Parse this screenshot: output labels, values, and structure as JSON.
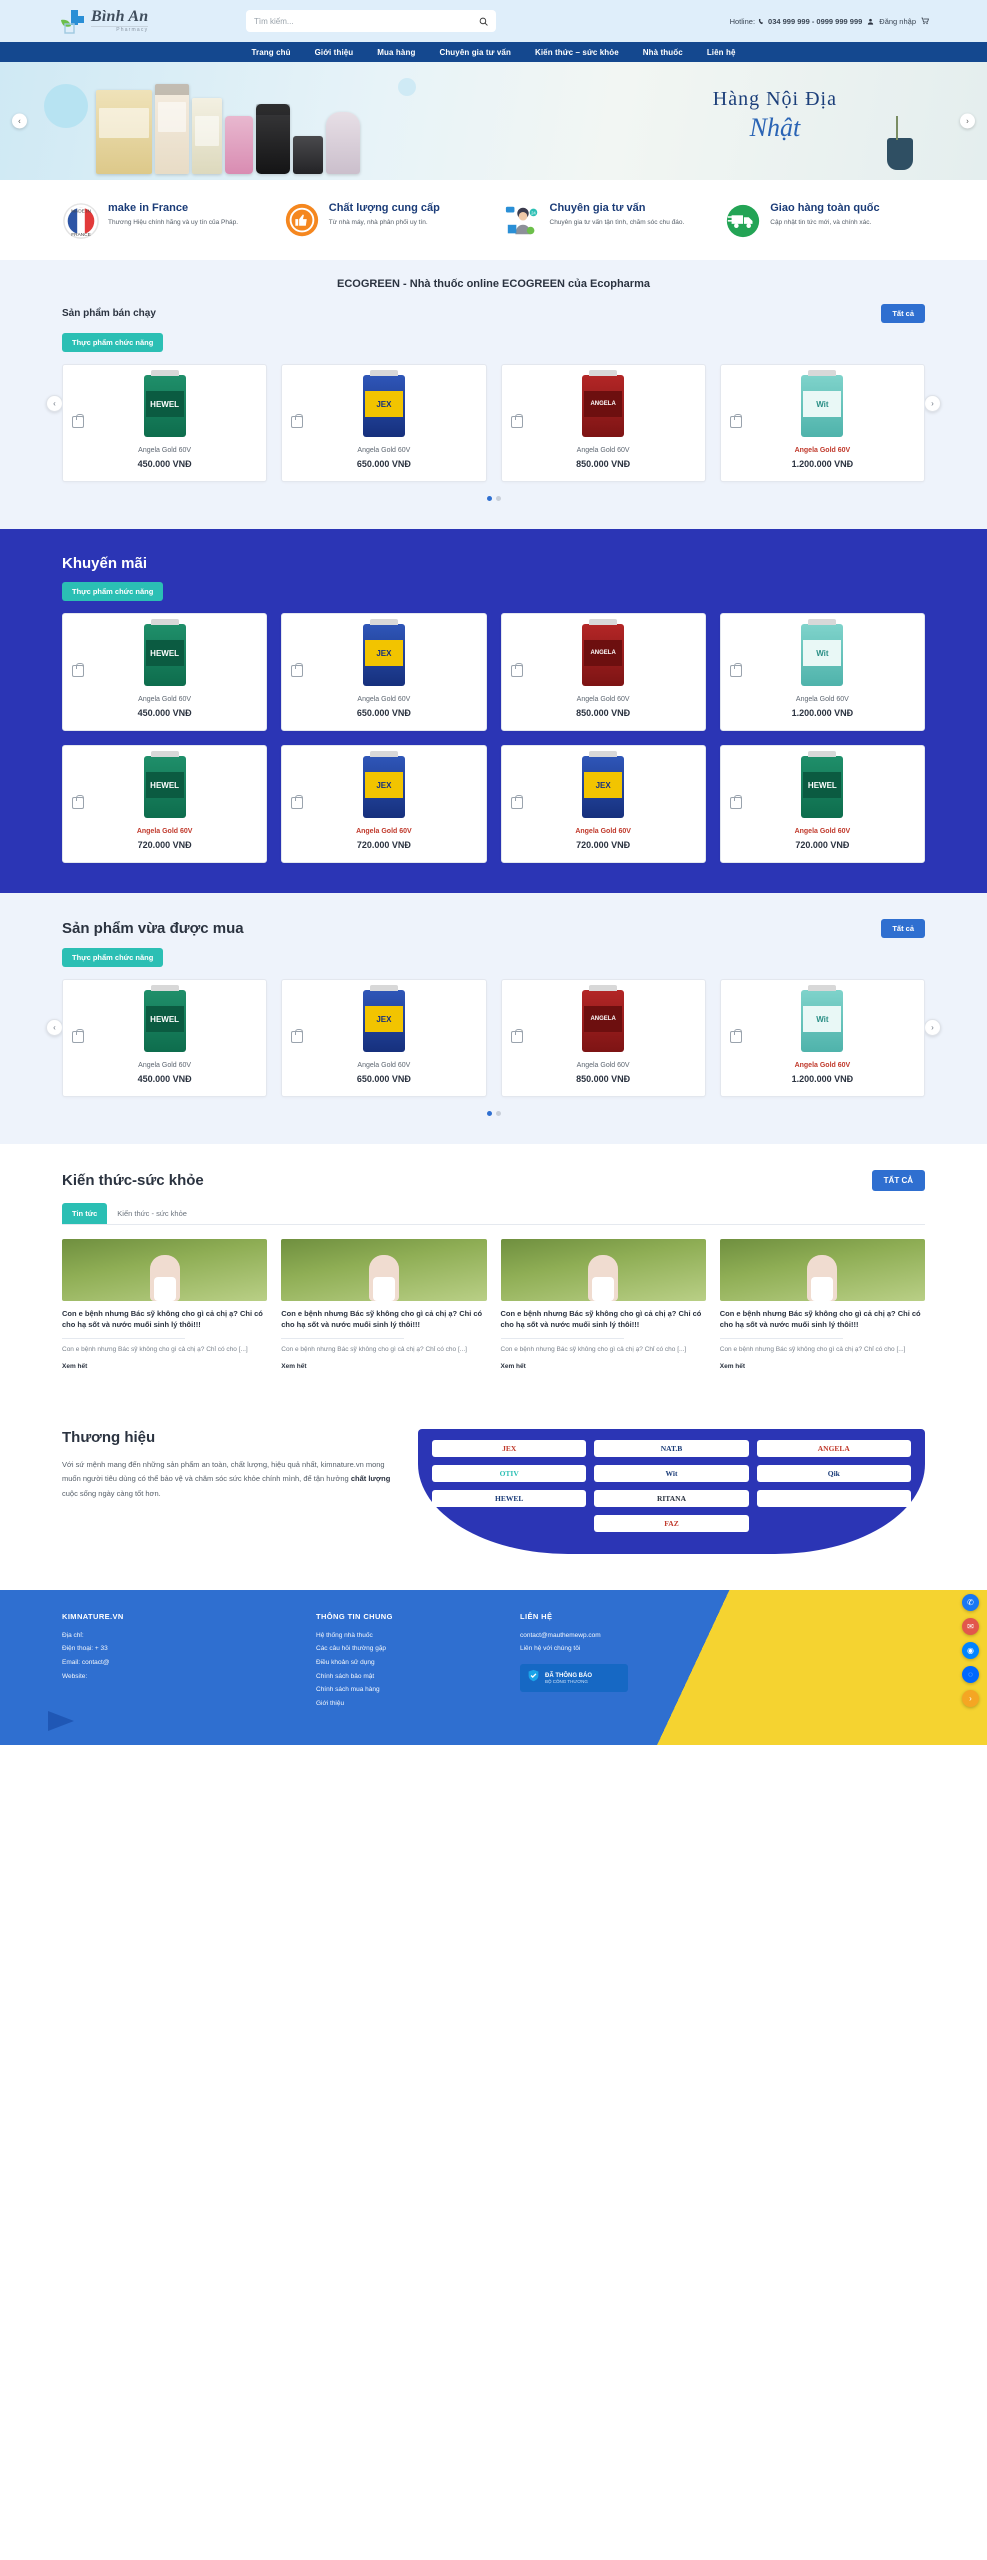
{
  "header": {
    "logo_name": "Bình An",
    "logo_sub": "Pharmacy",
    "logo_icon": "pharmacy-cross-leaf-icon",
    "search_placeholder": "Tìm kiếm...",
    "search_value": "",
    "search_icon": "search-icon",
    "hotline_label": "Hotline:",
    "phone_icon": "phone-icon",
    "hotline_numbers": "034 999 999 - 0999 999 999",
    "user_icon": "user-icon",
    "login_label": "Đăng nhập",
    "cart_icon": "cart-icon"
  },
  "nav": {
    "items": [
      {
        "label": "Trang chủ"
      },
      {
        "label": "Giới thiệu"
      },
      {
        "label": "Mua hàng"
      },
      {
        "label": "Chuyên gia tư vấn"
      },
      {
        "label": "Kiến thức – sức khỏe"
      },
      {
        "label": "Nhà thuốc"
      },
      {
        "label": "Liên hệ"
      }
    ]
  },
  "hero": {
    "title_line1": "Hàng Nội Địa",
    "title_line2": "Nhật",
    "prev_icon": "chevron-left-icon",
    "next_icon": "chevron-right-icon"
  },
  "features": [
    {
      "icon": "made-in-france-badge-icon",
      "title": "make in France",
      "desc": "Thương Hiệu chính hãng và uy tín của Pháp."
    },
    {
      "icon": "quality-thumbsup-badge-icon",
      "title": "Chất lượng cung cấp",
      "desc": "Từ nhà máy, nhà phân phối uy tín."
    },
    {
      "icon": "consultant-headset-icon",
      "title": "Chuyên gia tư vấn",
      "desc": "Chuyên gia tư vấn tận tình, chăm sóc chu đáo."
    },
    {
      "icon": "delivery-truck-icon",
      "title": "Giao hàng toàn quốc",
      "desc": "Cập nhật tin tức mới, và chính xác."
    }
  ],
  "best": {
    "banner_title": "ECOGREEN - Nhà thuốc online ECOGREEN của Ecopharma",
    "row_title": "Sản phẩm bán chạy",
    "all_label": "Tất cả",
    "chip_label": "Thực phẩm chức năng",
    "prev_icon": "chevron-left-icon",
    "next_icon": "chevron-right-icon",
    "products": [
      {
        "brand": "HEWEL",
        "style": "b-hewel",
        "name": "Angela Gold 60V",
        "price": "450.000 VNĐ",
        "cart_icon": "add-to-cart-icon"
      },
      {
        "brand": "JEX",
        "style": "b-jex",
        "name": "Angela Gold 60V",
        "price": "650.000 VNĐ",
        "cart_icon": "add-to-cart-icon"
      },
      {
        "brand": "ANGELA",
        "style": "b-ang",
        "name": "Angela Gold 60V",
        "price": "850.000 VNĐ",
        "cart_icon": "add-to-cart-icon"
      },
      {
        "brand": "Wit",
        "style": "b-wit",
        "name": "Angela Gold 60V",
        "price": "1.200.000 VNĐ",
        "cart_icon": "add-to-cart-icon",
        "highlight": true
      }
    ],
    "dots": 2
  },
  "promo": {
    "title": "Khuyến mãi",
    "chip_label": "Thực phẩm chức năng",
    "row1": [
      {
        "brand": "HEWEL",
        "style": "b-hewel",
        "name": "Angela Gold 60V",
        "price": "450.000 VNĐ",
        "cart_icon": "add-to-cart-icon"
      },
      {
        "brand": "JEX",
        "style": "b-jex",
        "name": "Angela Gold 60V",
        "price": "650.000 VNĐ",
        "cart_icon": "add-to-cart-icon"
      },
      {
        "brand": "ANGELA",
        "style": "b-ang",
        "name": "Angela Gold 60V",
        "price": "850.000 VNĐ",
        "cart_icon": "add-to-cart-icon"
      },
      {
        "brand": "Wit",
        "style": "b-wit",
        "name": "Angela Gold 60V",
        "price": "1.200.000 VNĐ",
        "cart_icon": "add-to-cart-icon"
      }
    ],
    "row2": [
      {
        "brand": "HEWEL",
        "style": "b-hewel",
        "name": "Angela Gold 60V",
        "price": "720.000 VNĐ",
        "cart_icon": "add-to-cart-icon",
        "highlight": true
      },
      {
        "brand": "JEX",
        "style": "b-jex",
        "name": "Angela Gold 60V",
        "price": "720.000 VNĐ",
        "cart_icon": "add-to-cart-icon",
        "highlight": true
      },
      {
        "brand": "JEX",
        "style": "b-jex",
        "name": "Angela Gold 60V",
        "price": "720.000 VNĐ",
        "cart_icon": "add-to-cart-icon",
        "highlight": true
      },
      {
        "brand": "HEWEL",
        "style": "b-hewel",
        "name": "Angela Gold 60V",
        "price": "720.000 VNĐ",
        "cart_icon": "add-to-cart-icon",
        "highlight": true
      }
    ]
  },
  "recent": {
    "title": "Sản phẩm vừa được mua",
    "all_label": "Tất cả",
    "chip_label": "Thực phẩm chức năng",
    "prev_icon": "chevron-left-icon",
    "next_icon": "chevron-right-icon",
    "products": [
      {
        "brand": "HEWEL",
        "style": "b-hewel",
        "name": "Angela Gold 60V",
        "price": "450.000 VNĐ",
        "cart_icon": "add-to-cart-icon"
      },
      {
        "brand": "JEX",
        "style": "b-jex",
        "name": "Angela Gold 60V",
        "price": "650.000 VNĐ",
        "cart_icon": "add-to-cart-icon"
      },
      {
        "brand": "ANGELA",
        "style": "b-ang",
        "name": "Angela Gold 60V",
        "price": "850.000 VNĐ",
        "cart_icon": "add-to-cart-icon"
      },
      {
        "brand": "Wit",
        "style": "b-wit",
        "name": "Angela Gold 60V",
        "price": "1.200.000 VNĐ",
        "cart_icon": "add-to-cart-icon",
        "highlight": true
      }
    ],
    "dots": 2
  },
  "news": {
    "title": "Kiến thức-sức khỏe",
    "all_label": "TẤT CẢ",
    "tabs": [
      {
        "label": "Tin tức",
        "active": true
      },
      {
        "label": "Kiến thức - sức khỏe",
        "active": false
      }
    ],
    "articles": [
      {
        "title": "Con e bệnh nhưng Bác sỹ không cho gì cả chị ạ? Chỉ có cho hạ sốt và nước muối sinh lý thôi!!!",
        "excerpt": "Con e bệnh nhưng Bác sỹ không cho gì cả chị ạ? Chỉ có cho [...]",
        "more": "Xem hết"
      },
      {
        "title": "Con e bệnh nhưng Bác sỹ không cho gì cả chị ạ? Chỉ có cho hạ sốt và nước muối sinh lý thôi!!!",
        "excerpt": "Con e bệnh nhưng Bác sỹ không cho gì cả chị ạ? Chỉ có cho [...]",
        "more": "Xem hết"
      },
      {
        "title": "Con e bệnh nhưng Bác sỹ không cho gì cả chị ạ? Chỉ có cho hạ sốt và nước muối sinh lý thôi!!!",
        "excerpt": "Con e bệnh nhưng Bác sỹ không cho gì cả chị ạ? Chỉ có cho [...]",
        "more": "Xem hết"
      },
      {
        "title": "Con e bệnh nhưng Bác sỹ không cho gì cả chị ạ? Chỉ có cho hạ sốt và nước muối sinh lý thôi!!!",
        "excerpt": "Con e bệnh nhưng Bác sỹ không cho gì cả chị ạ? Chỉ có cho [...]",
        "more": "Xem hết"
      }
    ]
  },
  "brands": {
    "title": "Thương hiệu",
    "desc_1": "Với sứ mệnh mang đến những sản phẩm an toàn, chất lượng, hiệu quả nhất, kimnature.vn mong muốn người tiêu dùng có thể bảo vệ và chăm sóc sức khỏe chính mình, để tận hưởng ",
    "desc_bold": "chất lượng",
    "desc_2": " cuộc sống ngày càng tốt hơn.",
    "logos": [
      {
        "label": "JEX",
        "color": "r"
      },
      {
        "label": "NAT.B",
        "color": "b"
      },
      {
        "label": "ANGELA",
        "color": "r"
      },
      {
        "label": "OTIV",
        "color": "g"
      },
      {
        "label": "Wit",
        "color": "b"
      },
      {
        "label": "Qik",
        "color": "b"
      },
      {
        "label": "HEWEL",
        "color": "b"
      },
      {
        "label": "RITANA",
        "color": "k"
      },
      {
        "label": "",
        "color": "k"
      },
      {
        "label": "FAZ",
        "color": "r"
      }
    ]
  },
  "footer": {
    "col1": {
      "title": "KIMNATURE.VN",
      "items": [
        "Địa chỉ:",
        "Điện thoại: + 33",
        "Email: contact@",
        "Website:"
      ]
    },
    "col2": {
      "title": "THÔNG TIN CHUNG",
      "items": [
        "Hệ thống nhà thuốc",
        "Các câu hỏi thường gặp",
        "Điều khoản sử dụng",
        "Chính sách bảo mật",
        "Chính sách mua hàng",
        "Giới thiệu"
      ]
    },
    "col3": {
      "title": "LIÊN HỆ",
      "items": [
        "contact@mauthemewp.com",
        "Liên hệ với chúng tôi"
      ],
      "badge_icon": "verified-shield-icon",
      "badge_line1": "ĐÃ THÔNG BÁO",
      "badge_line2": "BỘ CÔNG THƯƠNG"
    },
    "fabs": [
      {
        "icon": "phone-icon",
        "style": "blue"
      },
      {
        "icon": "email-icon",
        "style": "red"
      },
      {
        "icon": "messenger-icon",
        "style": "msg"
      },
      {
        "icon": "zalo-icon",
        "style": "zalo"
      },
      {
        "icon": "scroll-to-top-icon",
        "style": "up"
      }
    ]
  },
  "colors": {
    "nav_blue": "#14488f",
    "brand_blue": "#2f6fd0",
    "promo_blue": "#2b35b5",
    "teal": "#2bbfb4",
    "yellow": "#f5d330",
    "topbar_bg": "#dfeefa"
  }
}
